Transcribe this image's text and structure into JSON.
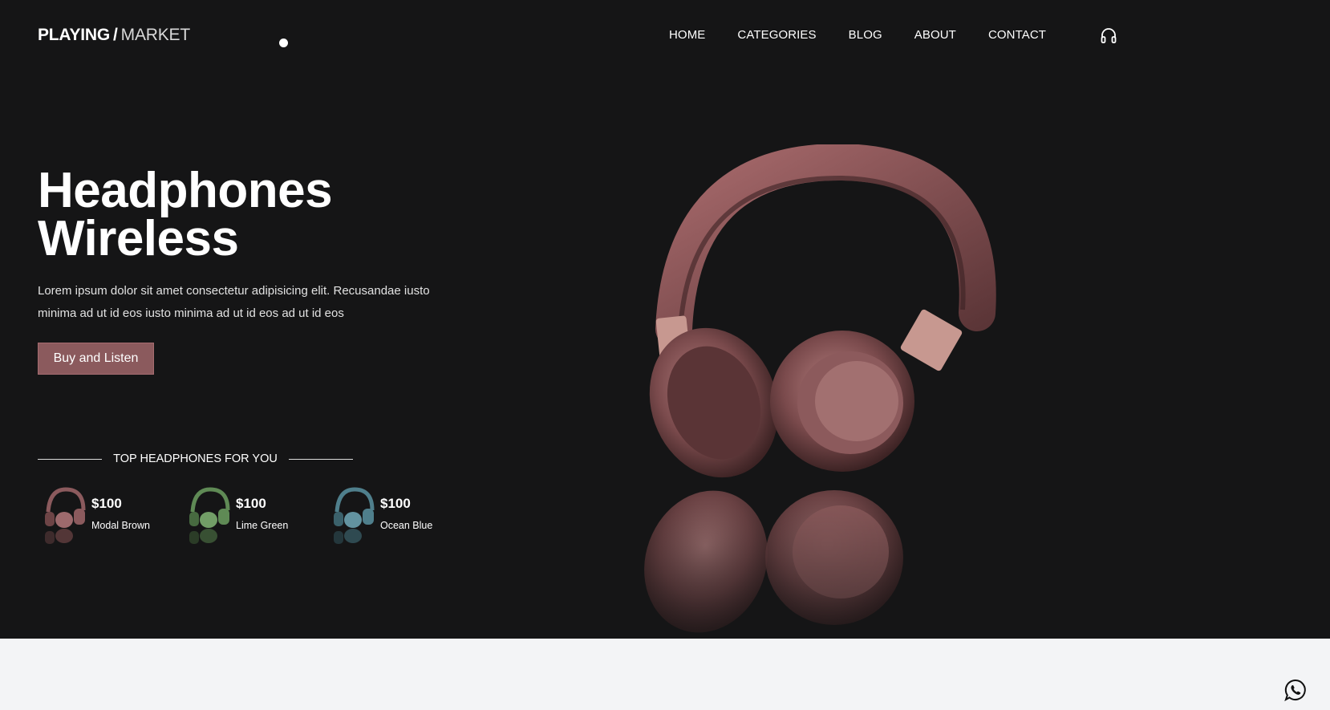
{
  "brand": {
    "strong": "PLAYING",
    "slash": "/",
    "light": "MARKET"
  },
  "nav": [
    "HOME",
    "CATEGORIES",
    "BLOG",
    "ABOUT",
    "CONTACT"
  ],
  "hero": {
    "title_line1": "Headphones",
    "title_line2": "Wireless",
    "description": "Lorem ipsum dolor sit amet consectetur adipisicing elit. Recusandae iusto minima ad ut id eos iusto minima ad ut id eos ad ut id eos",
    "cta": "Buy and Listen"
  },
  "top_section": {
    "label": "TOP HEADPHONES FOR YOU",
    "products": [
      {
        "price": "$100",
        "name": "Modal Brown",
        "color": "#8b5a5d"
      },
      {
        "price": "$100",
        "name": "Lime Green",
        "color": "#5f8a55"
      },
      {
        "price": "$100",
        "name": "Ocean Blue",
        "color": "#4f7f8c"
      }
    ]
  },
  "icons": {
    "cart": "headphones-icon",
    "chat": "whatsapp-icon"
  },
  "colors": {
    "hero_bg": "#151516",
    "accent": "#8b5a5d",
    "footer_bg": "#f3f4f6"
  }
}
